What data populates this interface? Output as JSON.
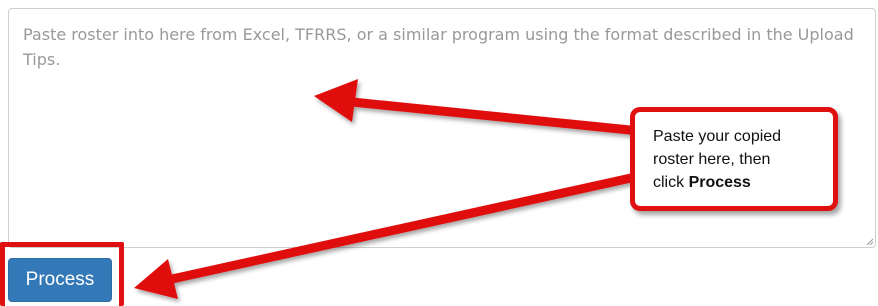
{
  "roster_input": {
    "placeholder": "Paste roster into here from Excel, TFRRS, or a similar program using the format described in the Upload Tips.",
    "value": ""
  },
  "process_button": {
    "label": "Process",
    "color": "#3479b7"
  },
  "callout": {
    "line1": "Paste your copied",
    "line2": "roster here, then",
    "line3_prefix": "click ",
    "line3_bold": "Process",
    "border_color": "#e01010"
  },
  "annotation_color": "#e01010"
}
